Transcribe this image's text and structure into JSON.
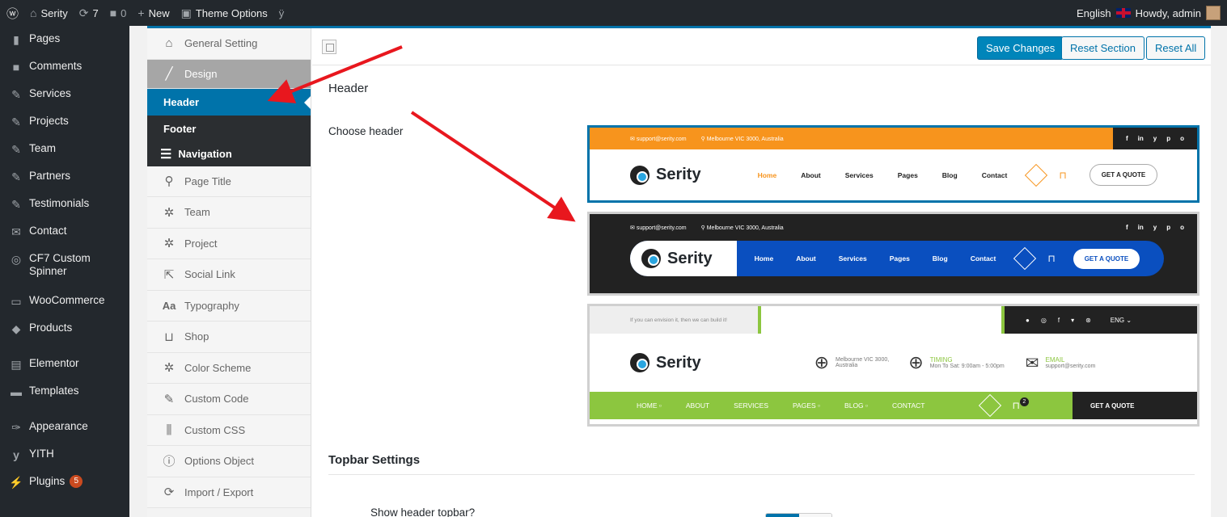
{
  "adminbar": {
    "site_name": "Serity",
    "updates_count": "7",
    "comments_count": "0",
    "new_label": "New",
    "theme_options_label": "Theme Options",
    "language": "English",
    "howdy": "Howdy, admin"
  },
  "wp_menu": [
    {
      "label": "Pages",
      "icon": "pages-icon"
    },
    {
      "label": "Comments",
      "icon": "comments-icon"
    },
    {
      "label": "Services",
      "icon": "pin-icon"
    },
    {
      "label": "Projects",
      "icon": "pin-icon"
    },
    {
      "label": "Team",
      "icon": "pin-icon"
    },
    {
      "label": "Partners",
      "icon": "pin-icon"
    },
    {
      "label": "Testimonials",
      "icon": "pin-icon"
    },
    {
      "label": "Contact",
      "icon": "mail-icon"
    },
    {
      "label": "CF7 Custom Spinner",
      "icon": "spinner-icon"
    },
    {
      "label": "WooCommerce",
      "icon": "woo-icon"
    },
    {
      "label": "Products",
      "icon": "products-icon"
    },
    {
      "label": "Elementor",
      "icon": "elementor-icon"
    },
    {
      "label": "Templates",
      "icon": "folder-icon"
    },
    {
      "label": "Appearance",
      "icon": "appearance-icon"
    },
    {
      "label": "YITH",
      "icon": "yith-icon"
    },
    {
      "label": "Plugins",
      "icon": "plugins-icon",
      "badge": "5"
    }
  ],
  "options_nav": {
    "general": "General Setting",
    "design": "Design",
    "header": "Header",
    "footer": "Footer",
    "navigation": "Navigation",
    "items": [
      "Page Title",
      "Team",
      "Project",
      "Social Link",
      "Typography",
      "Shop",
      "Color Scheme",
      "Custom Code",
      "Custom CSS",
      "Options Object",
      "Import / Export"
    ]
  },
  "toolbar": {
    "save": "Save Changes",
    "reset_section": "Reset Section",
    "reset_all": "Reset All"
  },
  "section": {
    "title": "Header",
    "choose_label": "Choose header",
    "topbar_title": "Topbar Settings",
    "show_topbar_label": "Show header topbar?"
  },
  "previews": {
    "p1": {
      "email": "support@serity.com",
      "address": "Melbourne VIC 3000, Australia",
      "social": [
        "f",
        "in",
        "y",
        "p",
        "o"
      ],
      "logo": "Serity",
      "nav": [
        "Home",
        "About",
        "Services",
        "Pages",
        "Blog",
        "Contact"
      ],
      "quote": "GET A QUOTE"
    },
    "p2": {
      "email": "support@serity.com",
      "address": "Melbourne VIC 3000, Australia",
      "social": [
        "f",
        "in",
        "y",
        "p",
        "o"
      ],
      "logo": "Serity",
      "nav": [
        "Home",
        "About",
        "Services",
        "Pages",
        "Blog",
        "Contact"
      ],
      "quote": "GET A QUOTE"
    },
    "p3": {
      "tagline": "If you can envision it, then we can build it!",
      "lang": "ENG ⌄",
      "logo": "Serity",
      "address_line1": "Melbourne VIC 3000,",
      "address_line2": "Australia",
      "timing_title": "TIMING",
      "timing_text": "Mon To Sat: 9:00am - 5:00pm",
      "email_title": "EMAIL",
      "email_text": "support@serity.com",
      "nav": [
        "HOME ▫",
        "ABOUT",
        "SERVICES",
        "PAGES ▫",
        "BLOG ▫",
        "CONTACT"
      ],
      "cart_count": "2",
      "quote": "GET A QUOTE"
    }
  },
  "colors": {
    "wp_dark": "#23282d",
    "wp_blue": "#0073aa",
    "orange": "#f7941d",
    "blue2": "#0a4fbf",
    "green": "#8cc63f",
    "arrow_red": "#e8171e"
  }
}
